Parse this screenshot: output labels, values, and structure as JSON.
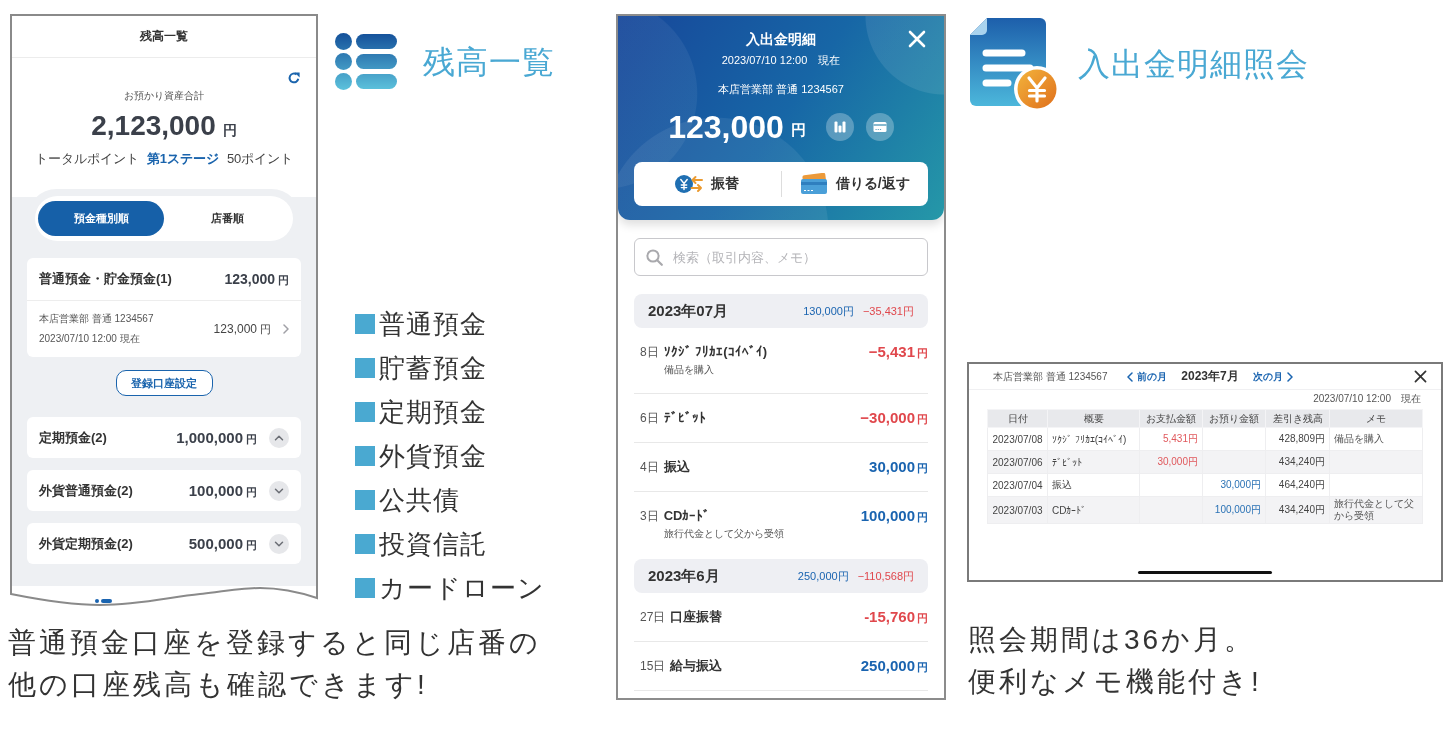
{
  "balance_panel": {
    "title": "残高一覧",
    "phone": {
      "title": "残高一覧",
      "total_label": "お預かり資産合計",
      "total": {
        "amount": "2,123,000",
        "unit": "円"
      },
      "points": {
        "label": "トータルポイント",
        "stage": "第1ステージ",
        "value": "50ポイント"
      },
      "sort_tabs": [
        {
          "label": "預金種別順",
          "selected": true
        },
        {
          "label": "店番順",
          "selected": false
        }
      ],
      "primary_group": {
        "name": "普通預金・貯金預金(1)",
        "amount": "123,000",
        "unit": "円",
        "accounts": [
          {
            "account": "本店営業部 普通 1234567",
            "as_of": "2023/07/10 12:00 現在",
            "amount": "123,000",
            "unit": "円"
          }
        ]
      },
      "register_button": "登録口座設定",
      "groups": [
        {
          "name": "定期預金(2)",
          "amount": "1,000,000",
          "unit": "円",
          "expanded": true
        },
        {
          "name": "外貨普通預金(2)",
          "amount": "100,000",
          "unit": "円",
          "expanded": false
        },
        {
          "name": "外貨定期預金(2)",
          "amount": "500,000",
          "unit": "円",
          "expanded": false
        }
      ]
    },
    "legend": [
      "普通預金",
      "貯蓄預金",
      "定期預金",
      "外貨預金",
      "公共債",
      "投資信託",
      "カードローン"
    ],
    "caption": [
      "普通預金口座を登録すると同じ店番の",
      "他の口座残高も確認できます!"
    ]
  },
  "statement_panel": {
    "header": {
      "title": "入出金明細",
      "as_of": "2023/07/10 12:00　現在",
      "account": "本店営業部 普通 1234567",
      "balance": {
        "amount": "123,000",
        "unit": "円"
      }
    },
    "actions": [
      {
        "kind": "transfer",
        "label": "振替"
      },
      {
        "kind": "loan",
        "label": "借りる/返す"
      }
    ],
    "search": {
      "placeholder": "検索（取引内容、メモ）"
    },
    "months": [
      {
        "label": "2023年07月",
        "income": "130,000円",
        "expense": "−35,431円",
        "transactions": [
          {
            "kind": "withdrawal",
            "day": "8日",
            "description": "ｿｸｼﾞ ﾌﾘｶｴ(ｺｲﾍﾞｲ)",
            "memo": "備品を購入",
            "amount": "−5,431",
            "unit": "円"
          },
          {
            "kind": "withdrawal",
            "day": "6日",
            "description": "ﾃﾞﾋﾞｯﾄ",
            "amount": "−30,000",
            "unit": "円"
          },
          {
            "kind": "deposit",
            "day": "4日",
            "description": "振込",
            "amount": "30,000",
            "unit": "円"
          },
          {
            "kind": "deposit",
            "day": "3日",
            "description": "CDｶｰﾄﾞ",
            "memo": "旅行代金として父から受領",
            "amount": "100,000",
            "unit": "円"
          }
        ]
      },
      {
        "label": "2023年6月",
        "income": "250,000円",
        "expense": "−110,568円",
        "transactions": [
          {
            "kind": "withdrawal",
            "day": "27日",
            "description": "口座振替",
            "amount": "-15,760",
            "unit": "円"
          },
          {
            "kind": "deposit",
            "day": "15日",
            "description": "給与振込",
            "amount": "250,000",
            "unit": "円"
          }
        ]
      }
    ]
  },
  "inquiry_panel": {
    "title": "入出金明細照会",
    "screen": {
      "account": "本店営業部 普通 1234567",
      "prev_label": "前の月",
      "month": "2023年7月",
      "next_label": "次の月",
      "as_of": "2023/07/10 12:00　現在",
      "columns": [
        "日付",
        "概要",
        "お支払金額",
        "お預り金額",
        "差引き残高",
        "メモ"
      ],
      "rows": [
        {
          "date": "2023/07/08",
          "summary": "ｿｸｼﾞ ﾌﾘｶｴ(ｺｲﾍﾞｲ)",
          "payment": "5,431円",
          "balance": "428,809円",
          "memo": "備品を購入"
        },
        {
          "date": "2023/07/06",
          "summary": "ﾃﾞﾋﾞｯﾄ",
          "payment": "30,000円",
          "balance": "434,240円"
        },
        {
          "date": "2023/07/04",
          "summary": "振込",
          "deposit": "30,000円",
          "balance": "464,240円"
        },
        {
          "date": "2023/07/03",
          "summary": "CDｶｰﾄﾞ",
          "deposit": "100,000円",
          "balance": "434,240円",
          "memo": "旅行代金として父から受領"
        }
      ]
    },
    "caption": [
      "照会期間は36か月。",
      "便利なメモ機能付き!"
    ]
  }
}
